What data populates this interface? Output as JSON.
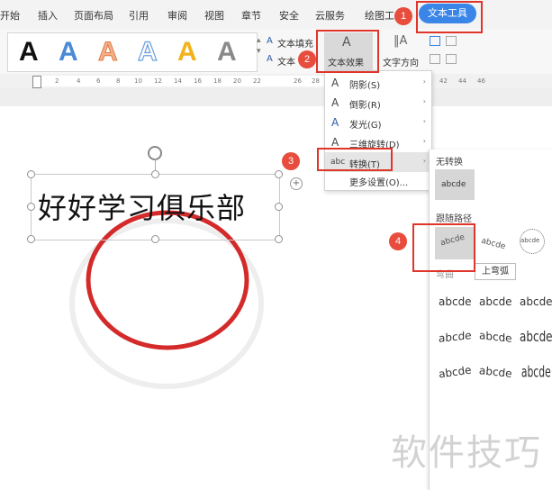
{
  "menubar": {
    "tabs": [
      "开始",
      "插入",
      "页面布局",
      "引用",
      "审阅",
      "视图",
      "章节",
      "安全",
      "云服务",
      "绘图工"
    ],
    "active_tab": "文本工具",
    "accent": "#3a86e8"
  },
  "ribbon": {
    "style_letter": "A",
    "text_fill_label": "文本填充",
    "text_outline_label": "文本",
    "text_effect_label": "文本效果",
    "text_direction_label": "文字方向"
  },
  "ruler": {
    "ticks": [
      "2",
      "4",
      "6",
      "8",
      "10",
      "12",
      "14",
      "16",
      "18",
      "20",
      "22",
      "26",
      "28",
      "42",
      "44",
      "46"
    ]
  },
  "document": {
    "art_text": "好好学习俱乐部"
  },
  "text_effect_menu": {
    "items": [
      {
        "icon": "A",
        "label": "阴影(S)"
      },
      {
        "icon": "A",
        "label": "倒影(R)"
      },
      {
        "icon": "A",
        "label": "发光(G)"
      },
      {
        "icon": "A",
        "label": "三维旋转(D)"
      },
      {
        "icon": "abc",
        "label": "转换(T)"
      },
      {
        "icon": "",
        "label": "更多设置(O)..."
      }
    ]
  },
  "transform_panel": {
    "no_transform_label": "无转换",
    "no_transform_sample": "abcde",
    "follow_path_label": "跟随路径",
    "warp_label": "弯曲",
    "path_samples": [
      "abcde",
      "abcde",
      "abcde"
    ],
    "warp_samples": [
      "abcde",
      "abcde",
      "abcde",
      "abcde",
      "abcde",
      "abcde",
      "abcde",
      "abcde",
      "abcde"
    ],
    "tooltip": "上弯弧"
  },
  "annotations": {
    "step_numbers": [
      "1",
      "2",
      "3",
      "4"
    ],
    "highlight_color": "#e0352b"
  },
  "watermark": "软件技巧"
}
